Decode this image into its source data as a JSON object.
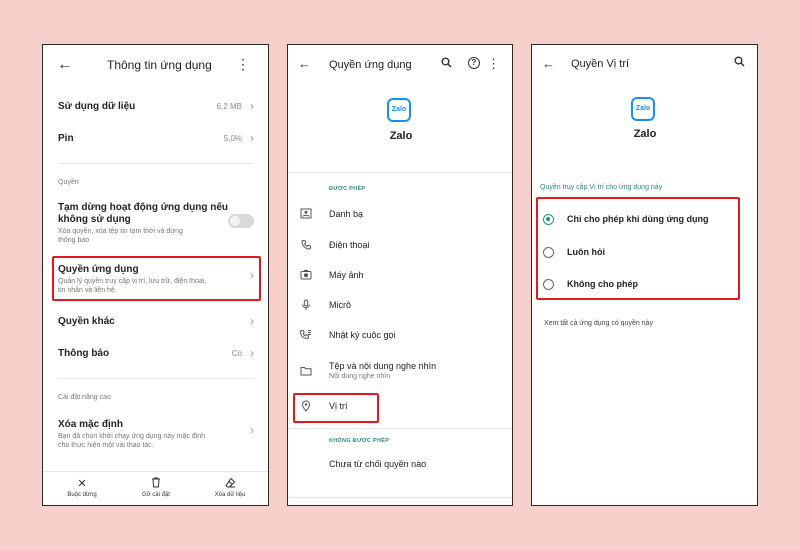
{
  "screen1": {
    "header": {
      "title": "Thông tin ứng dụng"
    },
    "data_usage": {
      "label": "Sử dụng dữ liệu",
      "value": "6,2 MB"
    },
    "battery": {
      "label": "Pin",
      "value": "5,0%"
    },
    "permissions_section": "Quyền",
    "pause_app": {
      "label_line1": "Tạm dừng hoạt động ứng dụng nếu",
      "label_line2": "không sử dụng",
      "sub_line1": "Xóa quyền, xóa tệp tin tạm thời và dừng",
      "sub_line2": "thông báo"
    },
    "app_permissions": {
      "label": "Quyền ứng dụng",
      "sub_line1": "Quản lý quyền truy cập vị trí, lưu trữ, điện thoại,",
      "sub_line2": "tin nhắn và liên hệ."
    },
    "other_permissions": {
      "label": "Quyền khác"
    },
    "notifications": {
      "label": "Thông báo",
      "value": "Có"
    },
    "advanced_section": "Cài đặt nâng cao",
    "clear_default": {
      "label": "Xóa mặc định",
      "sub_line1": "Bạn đã chọn khởi chạy ứng dụng này mặc định",
      "sub_line2": "cho thực hiện một vài thao tác."
    },
    "bottom_bar": {
      "force_stop": "Buộc dừng",
      "uninstall": "Gỡ cài đặt",
      "clear_data": "Xóa dữ liệu"
    }
  },
  "screen2": {
    "header": {
      "title": "Quyền ứng dụng"
    },
    "app": {
      "logo_text": "Zalo",
      "name": "Zalo"
    },
    "allowed_section": "ĐƯỢC PHÉP",
    "allowed_items": [
      {
        "label": "Danh bạ"
      },
      {
        "label": "Điện thoại"
      },
      {
        "label": "Máy ảnh"
      },
      {
        "label": "Micrô"
      },
      {
        "label": "Nhật ký cuộc gọi"
      },
      {
        "label": "Tệp và nội dung nghe nhìn",
        "sub": "Nội dung nghe nhìn"
      },
      {
        "label": "Vị trí"
      }
    ],
    "denied_section": "KHÔNG ĐƯỢC PHÉP",
    "denied_empty": "Chưa từ chối quyền nào"
  },
  "screen3": {
    "header": {
      "title": "Quyền Vị trí"
    },
    "app": {
      "logo_text": "Zalo",
      "name": "Zalo"
    },
    "section": "Quyền truy cập Vị trí cho ứng dụng này",
    "options": [
      {
        "label": "Chỉ cho phép khi dùng ứng dụng",
        "selected": true
      },
      {
        "label": "Luôn hỏi",
        "selected": false
      },
      {
        "label": "Không cho phép",
        "selected": false
      }
    ],
    "see_all": "Xem tất cả ứng dụng có quyền này"
  },
  "colors": {
    "background": "#f7cfcb",
    "highlight": "#e0191e",
    "accent": "#1f9a74",
    "zalo_blue": "#1a8ff0"
  }
}
